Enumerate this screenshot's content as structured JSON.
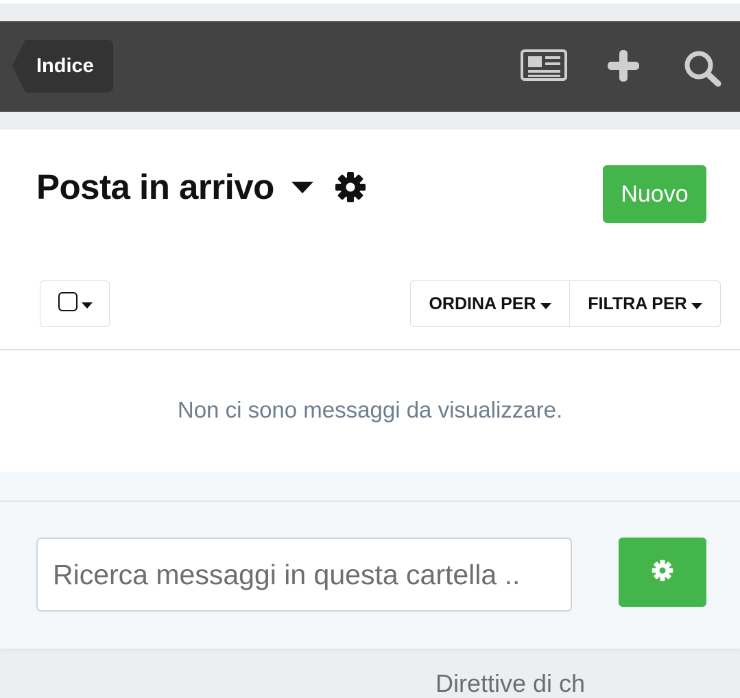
{
  "topbar": {
    "back_label": "Indice",
    "icons": [
      "newspaper-icon",
      "plus-icon",
      "search-icon"
    ]
  },
  "mailbox": {
    "title": "Posta in arrivo",
    "new_label": "Nuovo",
    "sort_label": "ORDINA PER",
    "filter_label": "FILTRA PER",
    "empty_message": "Non ci sono messaggi da visualizzare."
  },
  "search": {
    "placeholder": "Ricerca messaggi in questa cartella .."
  },
  "footer": {
    "cut_text": "Direttive di ch"
  },
  "colors": {
    "topbar_bg": "#434343",
    "back_button_bg": "#333333",
    "primary_green": "#44b54a",
    "muted_text": "#6f7e8e"
  }
}
